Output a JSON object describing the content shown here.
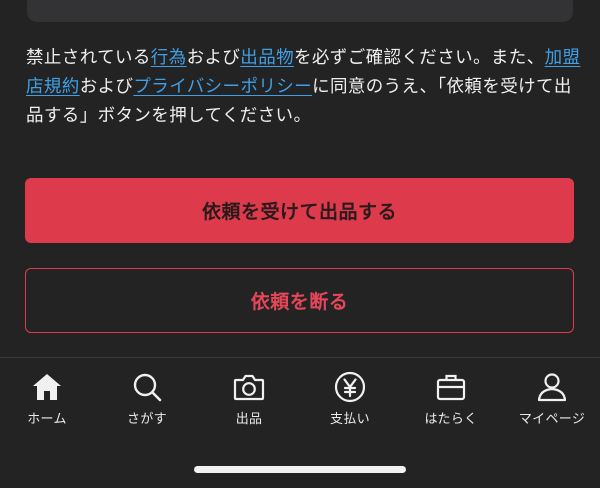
{
  "notice": {
    "text_1": "禁止されている",
    "link_prohibited_acts": "行為",
    "text_2": "および",
    "link_prohibited_items": "出品物",
    "text_3": "を必ずご確認ください。また、",
    "link_member_terms": "加盟店規約",
    "text_4": "および",
    "link_privacy_policy": "プライバシーポリシー",
    "text_5": "に同意のうえ、「依頼を受けて出品する」ボタンを押してください。",
    "link_color": "#3fa0e8"
  },
  "actions": {
    "accept_label": "依頼を受けて出品する",
    "decline_label": "依頼を断る",
    "accent_color": "#dd3b4c"
  },
  "tabbar": {
    "items": [
      {
        "label": "ホーム",
        "icon": "home-icon"
      },
      {
        "label": "さがす",
        "icon": "search-icon"
      },
      {
        "label": "出品",
        "icon": "camera-icon"
      },
      {
        "label": "支払い",
        "icon": "yen-icon"
      },
      {
        "label": "はたらく",
        "icon": "briefcase-icon"
      },
      {
        "label": "マイページ",
        "icon": "person-icon"
      }
    ]
  }
}
